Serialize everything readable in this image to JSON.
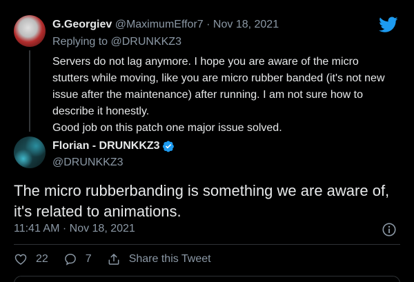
{
  "reply": {
    "name": "G.Georgiev",
    "handle": "@MaximumEffor7",
    "separator": "·",
    "date": "Nov 18, 2021",
    "replying_prefix": "Replying to ",
    "replying_to": "@DRUNKKZ3",
    "text": "Servers do not lag anymore. I hope you are aware of the micro stutters while moving, like you are micro rubber banded (it's not new issue after the maintenance) after running. I am not sure how to describe it honestly.\nGood job on this patch one major issue solved."
  },
  "tweet": {
    "name": "Florian - DRUNKKZ3",
    "handle": "@DRUNKKZ3",
    "text": "The micro rubberbanding is something we are aware of, it's related to animations.",
    "timestamp": "11:41 AM · Nov 18, 2021"
  },
  "actions": {
    "likes": "22",
    "replies": "7",
    "share_label": "Share this Tweet"
  },
  "icons": {
    "brand": "twitter-bird-icon",
    "verified": "verified-badge-icon",
    "info": "info-icon",
    "like": "heart-icon",
    "reply": "reply-bubble-icon",
    "share": "share-icon"
  },
  "colors": {
    "background": "#000000",
    "brand": "#1d9bf0",
    "muted": "#8b98a5",
    "text": "#e7e9ea"
  }
}
